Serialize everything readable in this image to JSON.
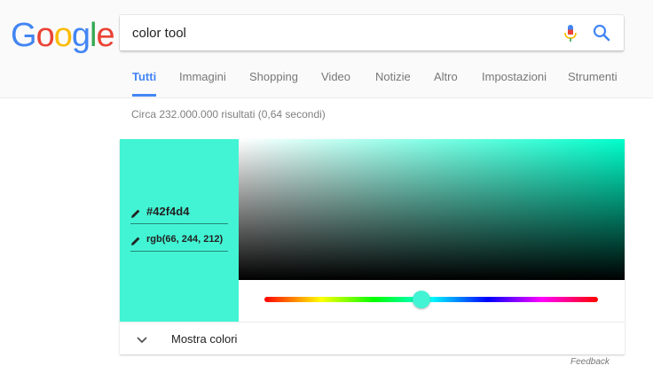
{
  "logo": {
    "letters": [
      {
        "char": "G",
        "color": "#4285f4"
      },
      {
        "char": "o",
        "color": "#ea4335"
      },
      {
        "char": "o",
        "color": "#fbbc05"
      },
      {
        "char": "g",
        "color": "#4285f4"
      },
      {
        "char": "l",
        "color": "#34a853"
      },
      {
        "char": "e",
        "color": "#ea4335"
      }
    ]
  },
  "search": {
    "value": "color tool",
    "mic_icon": "microphone-icon",
    "search_icon": "magnifier-icon"
  },
  "tabs": [
    {
      "label": "Tutti",
      "active": true
    },
    {
      "label": "Immagini",
      "active": false
    },
    {
      "label": "Shopping",
      "active": false
    },
    {
      "label": "Video",
      "active": false
    },
    {
      "label": "Notizie",
      "active": false
    },
    {
      "label": "Altro",
      "active": false
    },
    {
      "label": "Impostazioni",
      "active": false
    },
    {
      "label": "Strumenti",
      "active": false
    }
  ],
  "result_stats": "Circa 232.000.000 risultati (0,64 secondi)",
  "color_picker": {
    "selected_color": "#42f4d4",
    "hue_color": "#00ffcc",
    "hex_value": "#42f4d4",
    "rgb_value": "rgb(66, 244, 212)",
    "hue_position": 0.47,
    "expand_label": "Mostra colori",
    "expand_icon": "chevron-down-icon",
    "edit_icon": "pencil-icon"
  },
  "feedback": "Feedback",
  "colors": {
    "accent": "#4285f4",
    "header_bg": "#fafafa"
  }
}
